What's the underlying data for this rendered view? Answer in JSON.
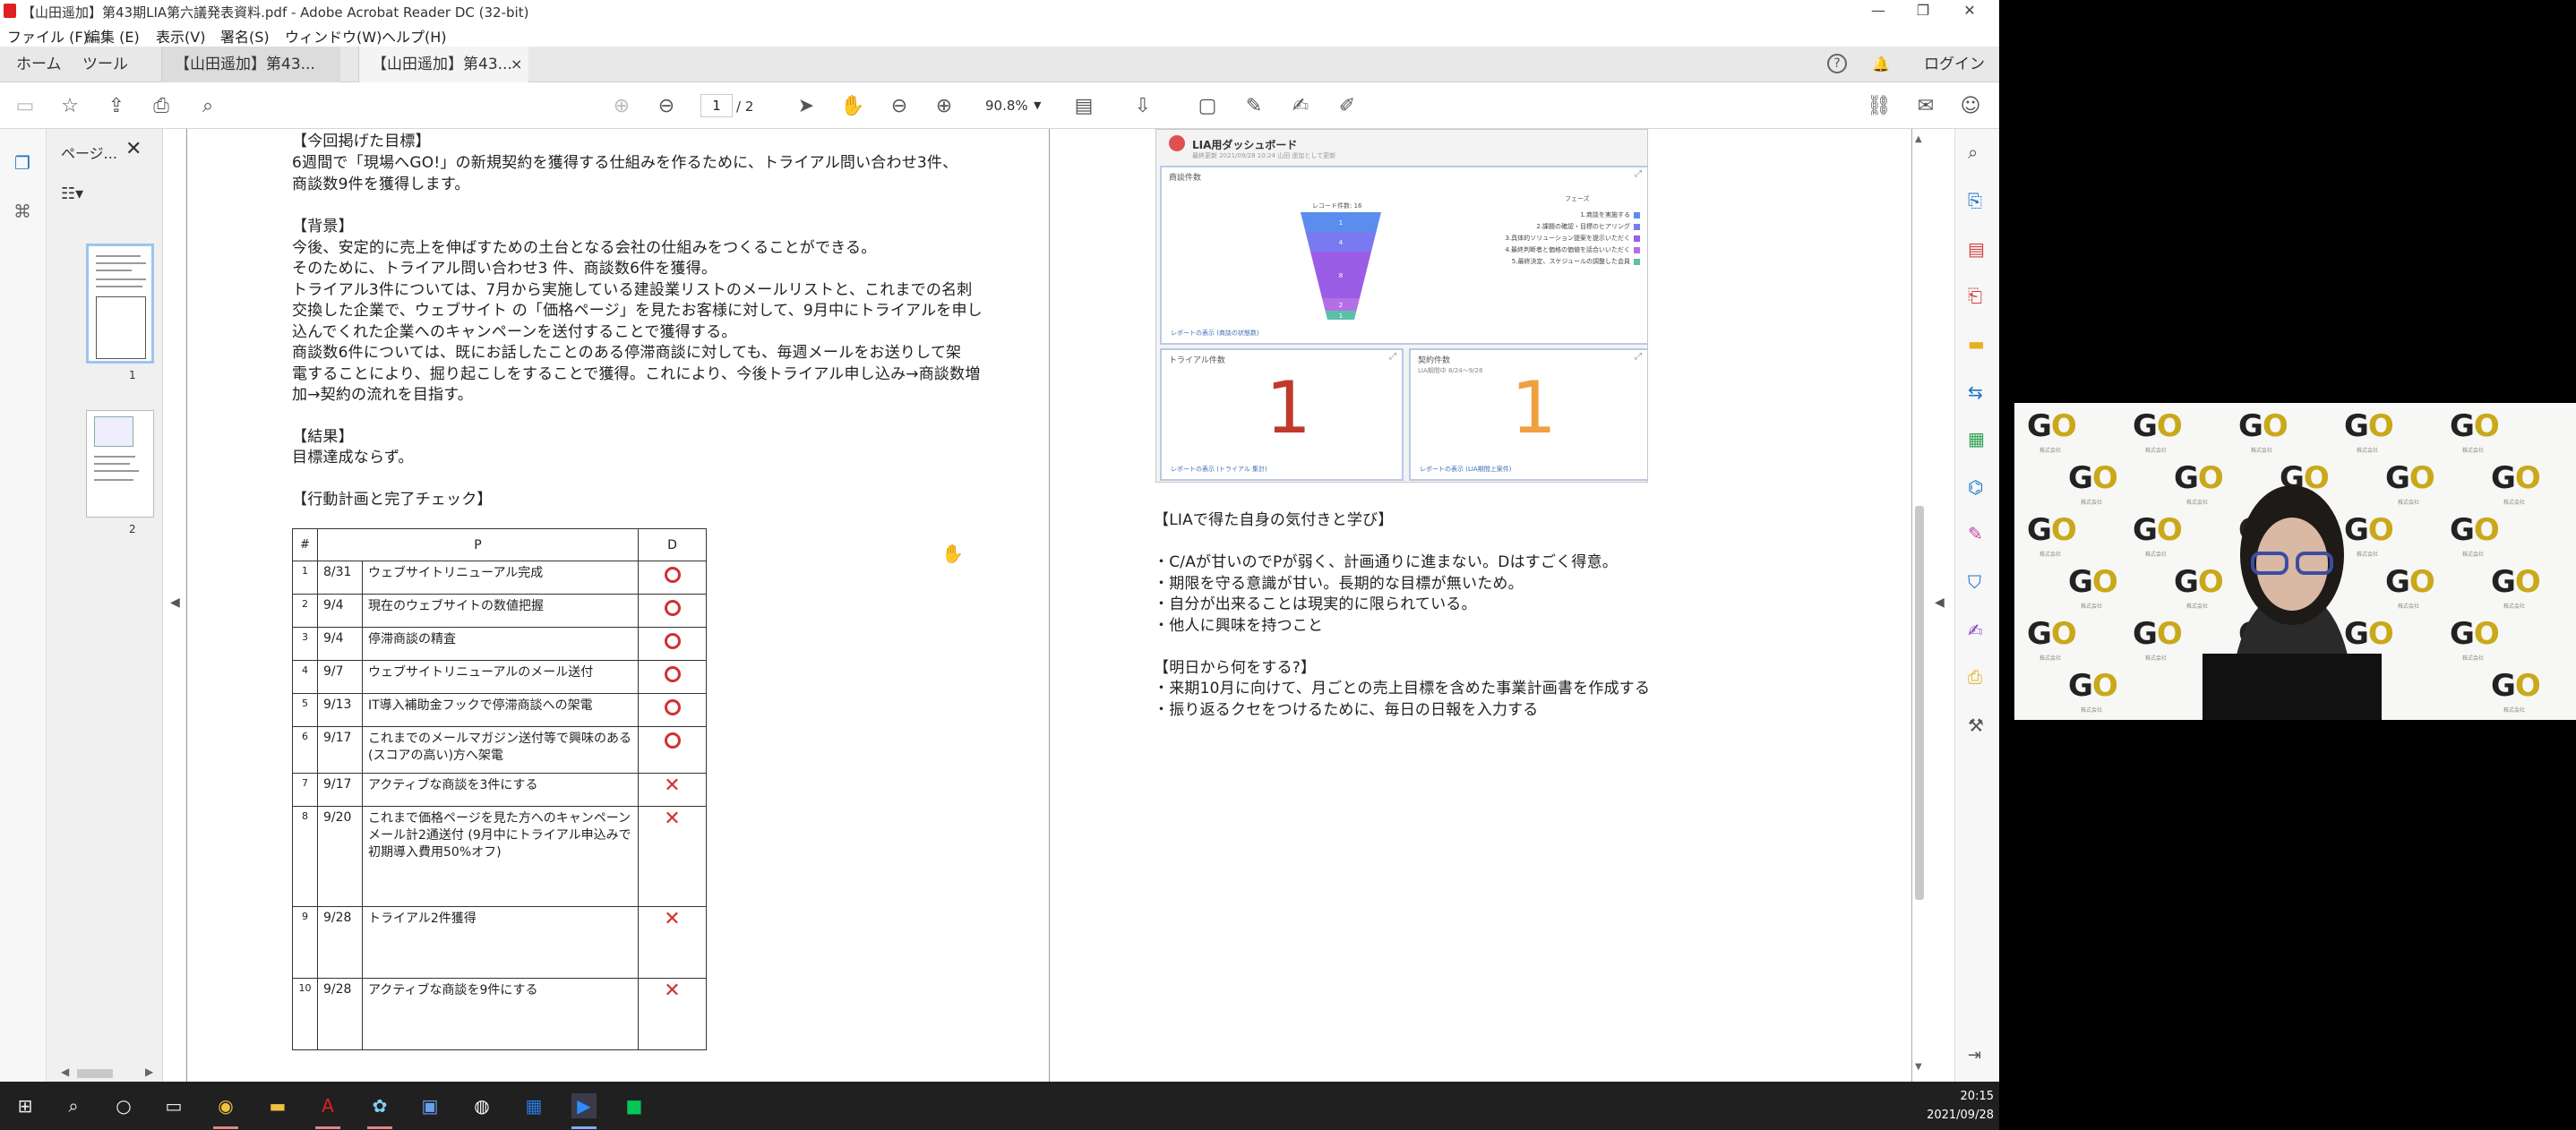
{
  "window": {
    "title": "【山田遥加】第43期LIA第六議発表資料.pdf - Adobe Acrobat Reader DC (32-bit)",
    "minimize": "—",
    "maximize": "❐",
    "close": "✕"
  },
  "menu": [
    "ファイル (F)",
    "編集 (E)",
    "表示(V)",
    "署名(S)",
    "ウィンドウ(W)",
    "ヘルプ(H)"
  ],
  "tabs": {
    "home": "ホーム",
    "tools": "ツール",
    "doc1": "【山田遥加】第43...",
    "doc2": "【山田遥加】第43...",
    "close_glyph": "×",
    "login": "ログイン"
  },
  "toolbar": {
    "page_current": "1",
    "page_total": "/ 2",
    "zoom": "90.8%"
  },
  "thumbs": {
    "panel_title": "ページ...",
    "page1_label": "1",
    "page2_label": "2"
  },
  "left_page": {
    "goal_heading": "【今回掲げた目標】",
    "goal_lines": [
      "6週間で「現場へGO!」の新規契約を獲得する仕組みを作るために、トライアル問い合わせ3件、",
      "商談数9件を獲得します。"
    ],
    "background_heading": "【背景】",
    "background_lines": [
      "今後、安定的に売上を伸ばすための土台となる会社の仕組みをつくることができる。",
      "そのために、トライアル問い合わせ3 件、商談数6件を獲得。",
      "トライアル3件については、7月から実施している建設業リストのメールリストと、これまでの名刺",
      "交換した企業で、ウェブサイト の「価格ページ」を見たお客様に対して、9月中にトライアルを申し",
      "込んでくれた企業へのキャンペーンを送付することで獲得する。",
      "商談数6件については、既にお話したことのある停滞商談に対しても、毎週メールをお送りして架",
      "電することにより、掘り起こしをすることで獲得。これにより、今後トライアル申し込み→商談数増",
      "加→契約の流れを目指す。"
    ],
    "result_heading": "【結果】",
    "result_text": "目標達成ならず。",
    "plan_heading": "【行動計画と完了チェック】",
    "table_headers": [
      "#",
      "P",
      "D"
    ],
    "rows": [
      {
        "n": "1",
        "date": "8/31",
        "task": "ウェブサイトリニューアル完成",
        "mark": "o"
      },
      {
        "n": "2",
        "date": "9/4",
        "task": "現在のウェブサイトの数値把握",
        "mark": "o"
      },
      {
        "n": "3",
        "date": "9/4",
        "task": "停滞商談の精査",
        "mark": "o"
      },
      {
        "n": "4",
        "date": "9/7",
        "task": "ウェブサイトリニューアルのメール送付",
        "mark": "o"
      },
      {
        "n": "5",
        "date": "9/13",
        "task": "IT導入補助金フックで停滞商談への架電",
        "mark": "o"
      },
      {
        "n": "6",
        "date": "9/17",
        "task": "これまでのメールマガジン送付等で興味のある(スコアの高い)方へ架電",
        "mark": "o"
      },
      {
        "n": "7",
        "date": "9/17",
        "task": "アクティブな商談を3件にする",
        "mark": "x"
      },
      {
        "n": "8",
        "date": "9/20",
        "task": "これまで価格ページを見た方へのキャンペーンメール計2通送付 (9月中にトライアル申込みで初期導入費用50%オフ)",
        "mark": "x"
      },
      {
        "n": "9",
        "date": "9/28",
        "task": "トライアル2件獲得",
        "mark": "x"
      },
      {
        "n": "10",
        "date": "9/28",
        "task": "アクティブな商談を9件にする",
        "mark": "x"
      }
    ]
  },
  "dashboard": {
    "title": "LIA用ダッシュボード",
    "subtitle": "最終更新 2021/09/28 10:24 山田 遥加として更新",
    "funnel_card_title": "商談件数",
    "funnel_caption": "レコード件数: 16",
    "funnel_values": [
      "1",
      "4",
      "8",
      "2",
      "1"
    ],
    "legend_title": "フェーズ",
    "legend": [
      {
        "label": "1.商談を実施する",
        "color": "#5b8def"
      },
      {
        "label": "2.課題の確認・目標のヒアリング",
        "color": "#7a7af0"
      },
      {
        "label": "3.具体的ソリューション提案を提示いただく",
        "color": "#9b5de5"
      },
      {
        "label": "4.最終判断者と価格の価値を話合いいただく",
        "color": "#b56fe6"
      },
      {
        "label": "5.最終決定、スケジュールの調整した会員",
        "color": "#5bc0a8"
      }
    ],
    "funnel_link": "レポートの表示 (商談の状態数)",
    "trial_title": "トライアル件数",
    "trial_value": "1",
    "trial_link": "レポートの表示 (トライアル 集計)",
    "contract_title": "契約件数",
    "contract_sub": "LIA期間中 8/24〜9/28",
    "contract_value": "1",
    "contract_link": "レポートの表示 (LIA期間上案件)",
    "colors": {
      "trial": "#c0392b",
      "contract": "#f0a040"
    }
  },
  "right_page": {
    "learn_heading": "【LIAで得た自身の気付きと学び】",
    "learn_lines": [
      "・C/Aが甘いのでPが弱く、計画通りに進まない。Dはすごく得意。",
      "・期限を守る意識が甘い。長期的な目標が無いため。",
      "・自分が出来ることは現実的に限られている。",
      "・他人に興味を持つこと"
    ],
    "next_heading": "【明日から何をする?】",
    "next_lines": [
      "・来期10月に向けて、月ごとの売上目標を含めた事業計画書を作成する",
      "・振り返るクセをつけるために、毎日の日報を入力する"
    ]
  },
  "taskbar": {
    "time": "20:15",
    "date": "2021/09/28"
  },
  "webcam": {
    "logo_text": "GO",
    "logo_caption": "株式会社"
  }
}
